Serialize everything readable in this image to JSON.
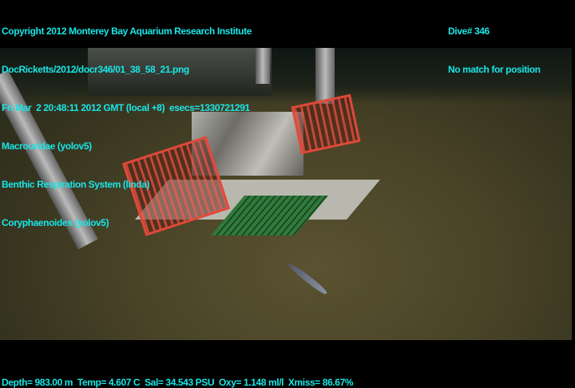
{
  "overlay_top_left": [
    "Copyright 2012 Monterey Bay Aquarium Research Institute",
    "DocRicketts/2012/docr346/01_38_58_21.png",
    "Fri Mar  2 20:48:11 2012 GMT (local +8)  esecs=1330721291",
    "Macrouridae (yolov5)",
    "Benthic Respiration System (linda)",
    "Coryphaenoides (yolov5)"
  ],
  "overlay_top_right": [
    "Dive# 346",
    "No match for position"
  ],
  "overlay_bottom": "Depth= 983.00 m  Temp= 4.607 C  Sal= 34.543 PSU  Oxy= 1.148 ml/l  Xmiss= 86.67%",
  "colors": {
    "overlay_text": "#19e6e6"
  }
}
